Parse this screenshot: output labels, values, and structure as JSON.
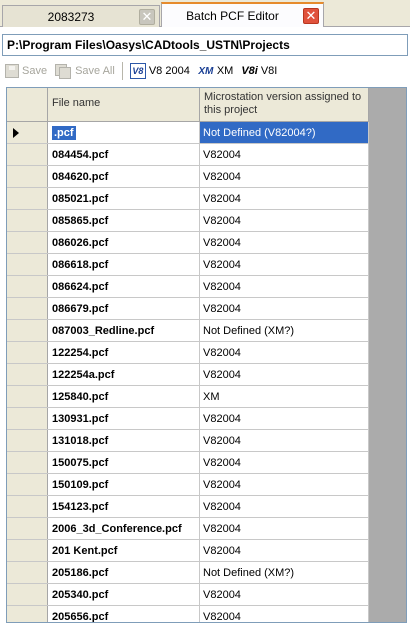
{
  "tabs": [
    {
      "label": "2083273",
      "active": false
    },
    {
      "label": "Batch PCF Editor",
      "active": true
    }
  ],
  "path": "P:\\Program Files\\Oasys\\CADtools_USTN\\Projects",
  "toolbar": {
    "save_label": "Save",
    "save_all_label": "Save All",
    "v8_label": "V8 2004",
    "xm_label": "XM",
    "v8i_label": "V8I",
    "v8i_icon_text": "V8i"
  },
  "grid": {
    "columns": [
      "File name",
      "Microstation version assigned to this project"
    ],
    "rows": [
      {
        "name": ".pcf",
        "version": "Not Defined (V82004?)",
        "selected": true
      },
      {
        "name": "084454.pcf",
        "version": "V82004"
      },
      {
        "name": "084620.pcf",
        "version": "V82004"
      },
      {
        "name": "085021.pcf",
        "version": "V82004"
      },
      {
        "name": "085865.pcf",
        "version": "V82004"
      },
      {
        "name": "086026.pcf",
        "version": "V82004"
      },
      {
        "name": "086618.pcf",
        "version": "V82004"
      },
      {
        "name": "086624.pcf",
        "version": "V82004"
      },
      {
        "name": "086679.pcf",
        "version": "V82004"
      },
      {
        "name": "087003_Redline.pcf",
        "version": "Not Defined (XM?)"
      },
      {
        "name": "122254.pcf",
        "version": "V82004"
      },
      {
        "name": "122254a.pcf",
        "version": "V82004"
      },
      {
        "name": "125840.pcf",
        "version": "XM"
      },
      {
        "name": "130931.pcf",
        "version": "V82004"
      },
      {
        "name": "131018.pcf",
        "version": "V82004"
      },
      {
        "name": "150075.pcf",
        "version": "V82004"
      },
      {
        "name": "150109.pcf",
        "version": "V82004"
      },
      {
        "name": "154123.pcf",
        "version": "V82004"
      },
      {
        "name": "2006_3d_Conference.pcf",
        "version": "V82004"
      },
      {
        "name": "201 Kent.pcf",
        "version": "V82004"
      },
      {
        "name": "205186.pcf",
        "version": "Not Defined (XM?)"
      },
      {
        "name": "205340.pcf",
        "version": "V82004"
      },
      {
        "name": "205656.pcf",
        "version": "V82004"
      }
    ]
  }
}
